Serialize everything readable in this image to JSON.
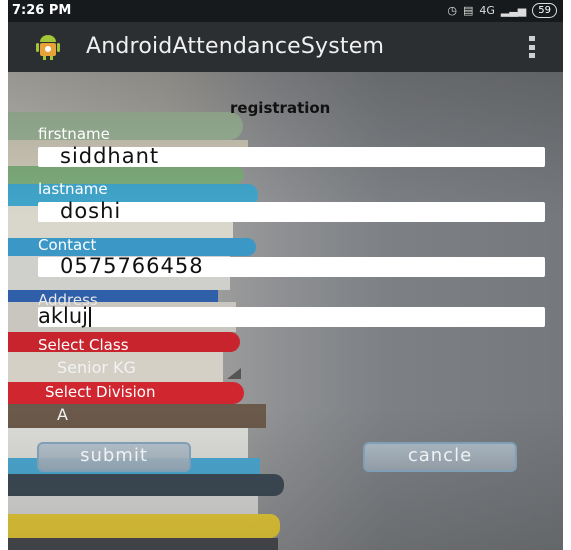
{
  "status_bar": {
    "time": "7:26 PM",
    "network": "4G",
    "battery": "59"
  },
  "app": {
    "title": "AndroidAttendanceSystem"
  },
  "form": {
    "heading": "registration",
    "firstname_label": "firstname",
    "firstname_value": "siddhant",
    "lastname_label": "lastname",
    "lastname_value": "doshi",
    "contact_label": "Contact",
    "contact_value": "0575766458",
    "address_label": "Address",
    "address_value": "akluj",
    "class_label": "Select Class",
    "class_value": "Senior KG",
    "division_label": "Select Division",
    "division_value": "A",
    "submit_label": "submit",
    "cancel_label": "cancle"
  },
  "colors": {
    "status_bar": "#171a1c",
    "action_bar": "#2b2f31",
    "field_background": "#ffffff",
    "button_border": "#7f9fb6"
  },
  "icons": {
    "app": "android-app-icon",
    "overflow": "overflow-menu-icon",
    "alarm": "alarm-icon",
    "signal": "signal-icon",
    "battery": "battery-icon"
  }
}
